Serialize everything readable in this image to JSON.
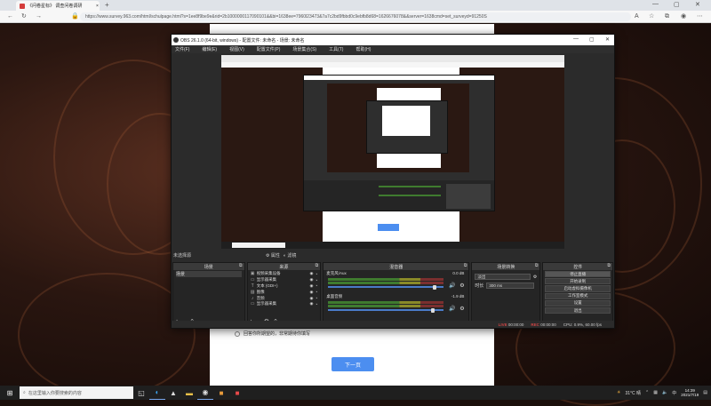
{
  "browser": {
    "tab_title": "《问卷星标》 调查问卷调研",
    "url": "https://www.survey.963.com/html/schulpage.html?s=1ee8f9be9e&rid=2b1000000117090101&&bi=1638ee=7960l23473&7a7c2bd9fbbd0c9ebfb8d68=1626676078&&server=1638cmd=set_surveyd=91250S",
    "page_options_label": "回答你所期望的，非常期待你填写",
    "next_button_label": "下一页"
  },
  "obs": {
    "title": "OBS 26.1.0 (64-bit, windows) - 配置文件: 未命名 - 场景: 未命名",
    "menu": [
      "文件(F)",
      "编辑(E)",
      "视图(V)",
      "配置文件(P)",
      "场景集合(S)",
      "工具(T)",
      "帮助(H)"
    ],
    "no_source_selected": "未选择源",
    "properties_label": "属性",
    "filters_label": "滤镜",
    "docks": {
      "scenes": "场景",
      "sources": "来源",
      "mixer": "混音器",
      "transitions": "场景转换",
      "controls": "控件"
    },
    "scene_items": [
      "场景"
    ],
    "source_items": [
      "视频采集设备",
      "显示器采集",
      "文本 (GDI+)",
      "图像",
      "音频",
      "显示器采集"
    ],
    "mixer_tracks": [
      {
        "name": "麦克风/Aux",
        "db": "0.0 dB"
      },
      {
        "name": "桌面音频",
        "db": "-1.9 dB"
      }
    ],
    "transition": {
      "type": "淡出",
      "duration_label": "时长",
      "duration_value": "300 ms"
    },
    "controls": [
      "停止直播",
      "开始录制",
      "启动虚拟摄像机",
      "工作室模式",
      "设置",
      "退出"
    ],
    "status": {
      "live": "LIVE",
      "live_time": "00:00:00",
      "rec": "REC",
      "rec_time": "00:00:00",
      "cpu": "CPU: 0.9%, 60.00 fps"
    }
  },
  "taskbar": {
    "search_placeholder": "在这里输入你要搜索的内容",
    "weather": "31°C 晴",
    "time": "14:39",
    "date": "2021/7/19"
  }
}
